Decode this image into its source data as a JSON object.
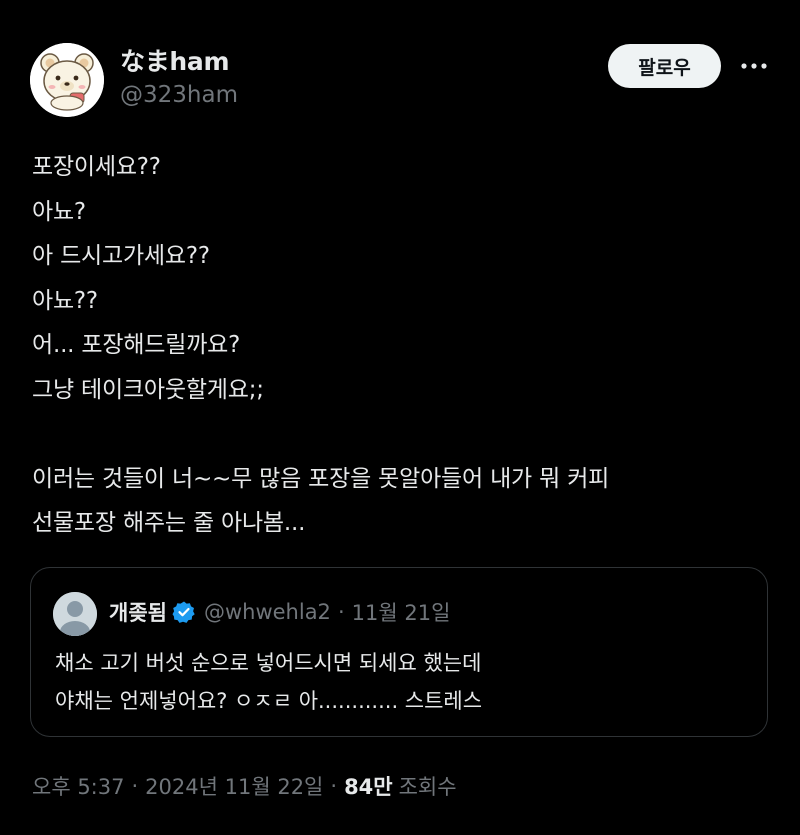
{
  "author": {
    "display_name": "なまham",
    "handle": "@323ham",
    "avatar_icon": "bear-avatar-icon"
  },
  "actions": {
    "follow_label": "팔로우",
    "more_icon": "more-horizontal-icon"
  },
  "tweet": {
    "text": "포장이세요??\n아뇨?\n아 드시고가세요??\n아뇨??\n어... 포장해드릴까요?\n그냥 테이크아웃할게요;;\n\n이러는 것들이 너~~무 많음 포장을 못알아들어 내가 뭐 커피\n선물포장 해주는 줄 아나봄..."
  },
  "quote": {
    "display_name": "개좆됨",
    "verified_icon": "verified-badge-icon",
    "handle": "@whwehla2",
    "separator": "·",
    "date": "11월 21일",
    "text": "채소 고기 버섯 순으로 넣어드시면 되세요 했는데\n야채는 언제넣어요? ㅇㅈㄹ 아............ 스트레스"
  },
  "meta": {
    "time": "오후 5:37",
    "separator": "·",
    "date": "2024년 11월 22일",
    "views_count": "84만",
    "views_label": "조회수"
  },
  "colors": {
    "background": "#000000",
    "text_primary": "#e7e9ea",
    "text_secondary": "#71767b",
    "border": "#2f3336",
    "follow_bg": "#eff3f4",
    "verified_blue": "#1d9bf0"
  }
}
